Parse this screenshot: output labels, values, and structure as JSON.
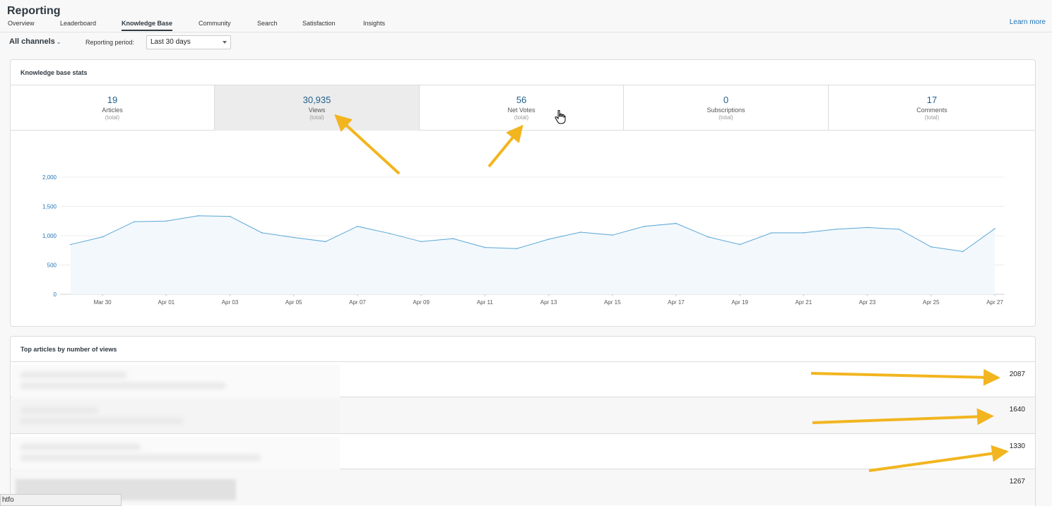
{
  "header": {
    "title": "Reporting",
    "tabs": [
      {
        "label": "Overview",
        "active": false
      },
      {
        "label": "Leaderboard",
        "active": false
      },
      {
        "label": "Knowledge Base",
        "active": true
      },
      {
        "label": "Community",
        "active": false
      },
      {
        "label": "Search",
        "active": false
      },
      {
        "label": "Satisfaction",
        "active": false
      },
      {
        "label": "Insights",
        "active": false
      }
    ],
    "learn_more": "Learn more"
  },
  "filters": {
    "channels": "All channels",
    "period_label": "Reporting period:",
    "period_value": "Last 30 days"
  },
  "stats": {
    "title": "Knowledge base stats",
    "items": [
      {
        "value": "19",
        "label": "Articles",
        "sub": "(total)"
      },
      {
        "value": "30,935",
        "label": "Views",
        "sub": "(total)",
        "selected": true
      },
      {
        "value": "56",
        "label": "Net Votes",
        "sub": "(total)"
      },
      {
        "value": "0",
        "label": "Subscriptions",
        "sub": "(total)"
      },
      {
        "value": "17",
        "label": "Comments",
        "sub": "(total)"
      }
    ]
  },
  "chart_data": {
    "type": "area",
    "title": "",
    "xlabel": "",
    "ylabel": "",
    "ylim": [
      0,
      2000
    ],
    "yticks": [
      "0",
      "500",
      "1,000",
      "1,500",
      "2,000"
    ],
    "xtick_labels": [
      "Mar 30",
      "Apr 01",
      "Apr 03",
      "Apr 05",
      "Apr 07",
      "Apr 09",
      "Apr 11",
      "Apr 13",
      "Apr 15",
      "Apr 17",
      "Apr 19",
      "Apr 21",
      "Apr 23",
      "Apr 25",
      "Apr 27"
    ],
    "x": [
      "Mar 29",
      "Mar 30",
      "Mar 31",
      "Apr 01",
      "Apr 02",
      "Apr 03",
      "Apr 04",
      "Apr 05",
      "Apr 06",
      "Apr 07",
      "Apr 08",
      "Apr 09",
      "Apr 10",
      "Apr 11",
      "Apr 12",
      "Apr 13",
      "Apr 14",
      "Apr 15",
      "Apr 16",
      "Apr 17",
      "Apr 18",
      "Apr 19",
      "Apr 20",
      "Apr 21",
      "Apr 22",
      "Apr 23",
      "Apr 24",
      "Apr 25",
      "Apr 26",
      "Apr 27"
    ],
    "series": [
      {
        "values": [
          850,
          980,
          1240,
          1250,
          1340,
          1330,
          1050,
          970,
          900,
          1160,
          1040,
          900,
          950,
          800,
          780,
          940,
          1060,
          1010,
          1160,
          1210,
          980,
          850,
          1050,
          1050,
          1110,
          1140,
          1110,
          810,
          730,
          1120
        ],
        "color": "#5aa7d6"
      }
    ],
    "grid": true
  },
  "articles": {
    "title": "Top articles by number of views",
    "rows": [
      {
        "count": "2087"
      },
      {
        "count": "1640"
      },
      {
        "count": "1330"
      },
      {
        "count": "1267"
      }
    ]
  },
  "status_bar": "htfo"
}
